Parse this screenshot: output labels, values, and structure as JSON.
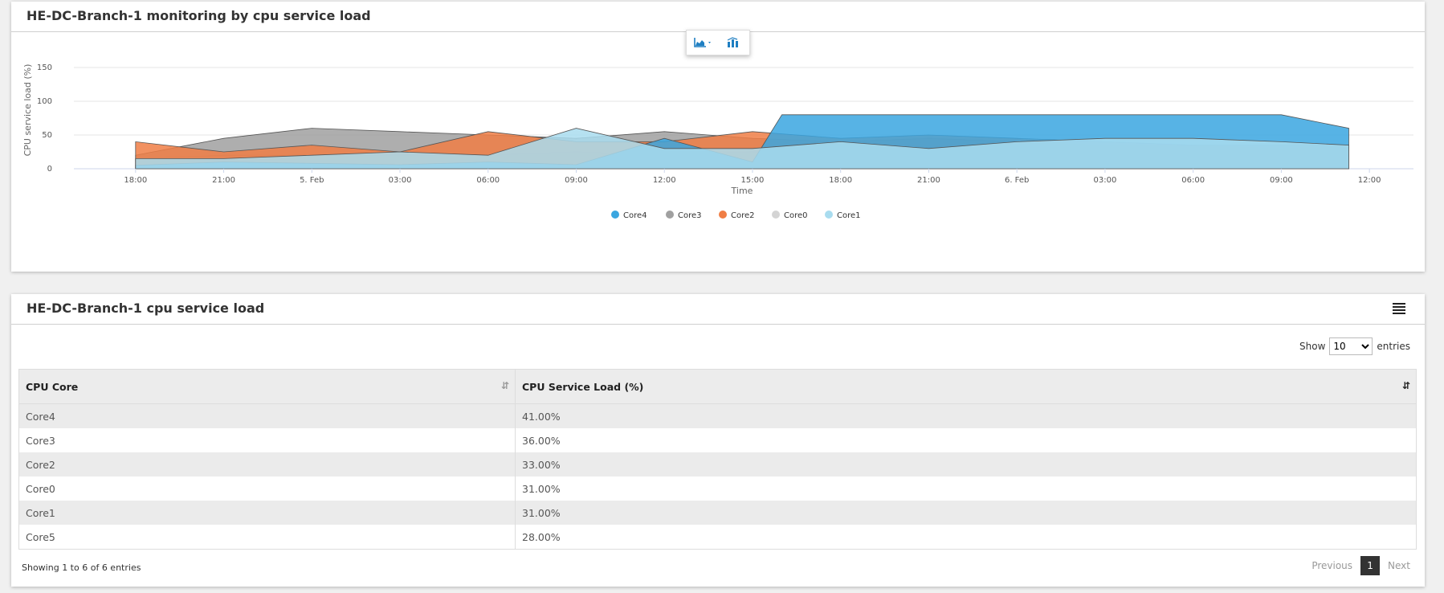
{
  "chart_panel": {
    "title": "HE-DC-Branch-1 monitoring by cpu service load"
  },
  "toolbar": {
    "area_icon": "area-chart-icon",
    "bar_icon": "bar-chart-icon"
  },
  "chart_data": {
    "type": "area",
    "ylabel": "CPU service load (%)",
    "xlabel": "Time",
    "ylim": [
      0,
      150
    ],
    "yticks": [
      0,
      50,
      100,
      150
    ],
    "x_ticks": [
      "18:00",
      "21:00",
      "5. Feb",
      "03:00",
      "06:00",
      "09:00",
      "12:00",
      "15:00",
      "18:00",
      "21:00",
      "6. Feb",
      "03:00",
      "06:00",
      "09:00",
      "12:00"
    ],
    "x_range_hours": [
      -2.1,
      43.5
    ],
    "legend": [
      "Core4",
      "Core3",
      "Core2",
      "Core0",
      "Core1"
    ],
    "legend_position": "bottom-center",
    "grid": true,
    "series": [
      {
        "name": "Core4",
        "color": "#3aa6e0",
        "x": [
          0,
          3,
          6,
          9,
          12,
          15,
          18,
          21,
          22,
          24,
          27,
          30,
          33,
          36,
          39,
          41.3
        ],
        "values": [
          5,
          10,
          8,
          6,
          10,
          6,
          45,
          10,
          80,
          80,
          80,
          80,
          80,
          80,
          80,
          60
        ]
      },
      {
        "name": "Core3",
        "color": "#a0a0a0",
        "x": [
          0,
          3,
          6,
          9,
          12,
          15,
          18,
          21,
          24,
          27,
          30,
          33,
          36,
          39,
          41.3
        ],
        "values": [
          20,
          45,
          60,
          55,
          50,
          45,
          55,
          45,
          40,
          45,
          40,
          35,
          35,
          30,
          35
        ]
      },
      {
        "name": "Core2",
        "color": "#f07e45",
        "x": [
          0,
          3,
          6,
          9,
          12,
          15,
          18,
          21,
          24,
          27,
          30,
          33,
          36,
          39,
          41.3
        ],
        "values": [
          40,
          25,
          35,
          25,
          55,
          40,
          40,
          55,
          45,
          50,
          45,
          40,
          35,
          35,
          35
        ]
      },
      {
        "name": "Core0",
        "color": "#d4d4d4",
        "x": [
          0,
          3,
          6,
          9,
          12,
          15,
          18,
          21,
          24,
          27,
          30,
          33,
          36,
          39,
          41.3
        ],
        "values": [
          15,
          20,
          20,
          20,
          20,
          25,
          20,
          25,
          25,
          25,
          25,
          25,
          25,
          25,
          25
        ]
      },
      {
        "name": "Core1",
        "color": "#a9dcef",
        "x": [
          0,
          3,
          6,
          9,
          12,
          15,
          18,
          21,
          24,
          27,
          30,
          33,
          36,
          39,
          41.3
        ],
        "values": [
          15,
          15,
          20,
          25,
          20,
          60,
          30,
          30,
          40,
          30,
          40,
          45,
          45,
          40,
          35
        ]
      }
    ]
  },
  "table_panel": {
    "title": "HE-DC-Branch-1 cpu service load",
    "menu_icon": "hamburger-menu-icon",
    "show_label": "Show",
    "entries_label": "entries",
    "page_size": "10",
    "page_size_options": [
      "10"
    ],
    "columns": [
      "CPU Core",
      "CPU Service Load (%)"
    ],
    "rows": [
      [
        "Core4",
        "41.00%"
      ],
      [
        "Core3",
        "36.00%"
      ],
      [
        "Core2",
        "33.00%"
      ],
      [
        "Core0",
        "31.00%"
      ],
      [
        "Core1",
        "31.00%"
      ],
      [
        "Core5",
        "28.00%"
      ]
    ],
    "info": "Showing 1 to 6 of 6 entries",
    "pagination": {
      "previous": "Previous",
      "current": "1",
      "next": "Next"
    }
  }
}
